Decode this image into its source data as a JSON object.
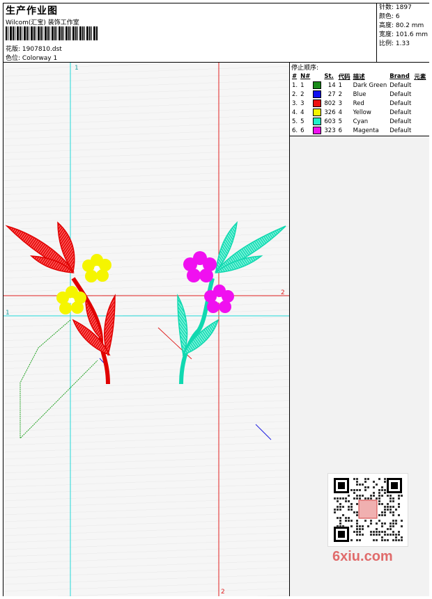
{
  "header": {
    "title": "生产作业图",
    "company": "Wilcom(汇宝) 装饰工作室",
    "design_label": "花版:",
    "design_file": "1907810.dst",
    "colorway_label": "色位:",
    "colorway": "Colorway 1"
  },
  "stats": {
    "stitches": "针数: 1897",
    "colors": "颜色: 6",
    "height": "高度: 80.2 mm",
    "width": "宽度: 101.6 mm",
    "scale": "比例: 1.33"
  },
  "color_panel": {
    "sequence_label": "停止顺序:",
    "columns": [
      "#",
      "N#",
      "St.",
      "代码",
      "描述",
      "Brand",
      "元素"
    ],
    "rows": [
      {
        "n": "1.",
        "num": "1",
        "color": "#1a8a1a",
        "st": "14",
        "code": "1",
        "desc": "Dark Green",
        "brand": "Default"
      },
      {
        "n": "2.",
        "num": "2",
        "color": "#1010ee",
        "st": "27",
        "code": "2",
        "desc": "Blue",
        "brand": "Default"
      },
      {
        "n": "3.",
        "num": "3",
        "color": "#ee1010",
        "st": "802",
        "code": "3",
        "desc": "Red",
        "brand": "Default"
      },
      {
        "n": "4.",
        "num": "4",
        "color": "#f5f500",
        "st": "326",
        "code": "4",
        "desc": "Yellow",
        "brand": "Default"
      },
      {
        "n": "5.",
        "num": "5",
        "color": "#20f0c8",
        "st": "603",
        "code": "5",
        "desc": "Cyan",
        "brand": "Default"
      },
      {
        "n": "6.",
        "num": "6",
        "color": "#f010f0",
        "st": "323",
        "code": "6",
        "desc": "Magenta",
        "brand": "Default"
      }
    ]
  },
  "guides": {
    "v1_label": "1",
    "h1_label": "1",
    "h2_label": "2",
    "v2_label": "2"
  },
  "watermark": "6xiu.com"
}
